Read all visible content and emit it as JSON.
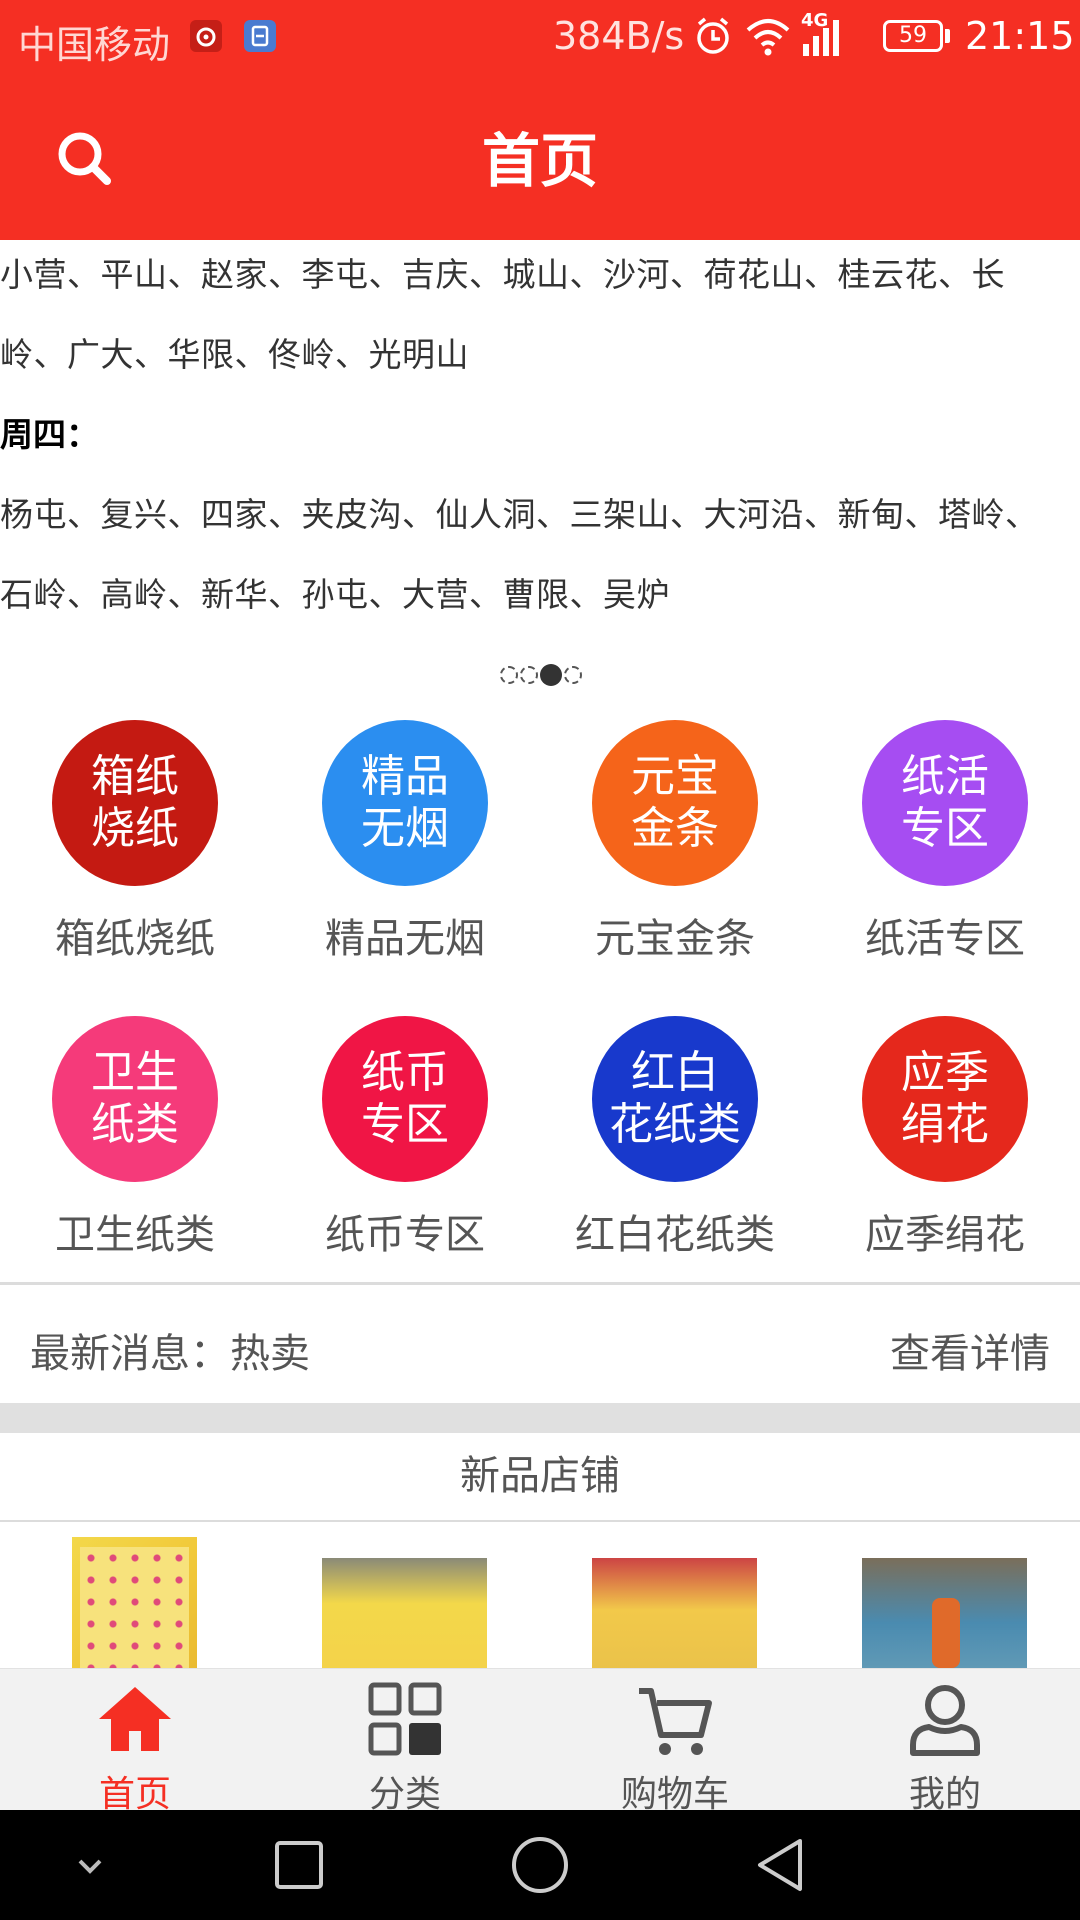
{
  "status_bar": {
    "carrier": "中国移动",
    "net_speed": "384B/s",
    "network_type": "4G",
    "battery": "59",
    "time": "21:15"
  },
  "header": {
    "title": "首页",
    "search_icon": "search-icon"
  },
  "banner": {
    "line1": "小营、平山、赵家、李屯、吉庆、城山、沙河、荷花山、桂云花、长",
    "line2": "岭、广大、华限、佟岭、光明山",
    "day_label": "周四：",
    "line3": "杨屯、复兴、四家、夹皮沟、仙人洞、三架山、大河沿、新甸、塔岭、",
    "line4": "石岭、高岭、新华、孙屯、大营、曹限、吴炉",
    "active_index": 2,
    "page_count": 4
  },
  "categories": [
    {
      "circle_line1": "箱纸",
      "circle_line2": "烧纸",
      "label": "箱纸烧纸",
      "color": "#c41a12"
    },
    {
      "circle_line1": "精品",
      "circle_line2": "无烟",
      "label": "精品无烟",
      "color": "#2b8ef0"
    },
    {
      "circle_line1": "元宝",
      "circle_line2": "金条",
      "label": "元宝金条",
      "color": "#f5641a"
    },
    {
      "circle_line1": "纸活",
      "circle_line2": "专区",
      "label": "纸活专区",
      "color": "#a64df2"
    },
    {
      "circle_line1": "卫生",
      "circle_line2": "纸类",
      "label": "卫生纸类",
      "color": "#f53a7a"
    },
    {
      "circle_line1": "纸币",
      "circle_line2": "专区",
      "label": "纸币专区",
      "color": "#f01545"
    },
    {
      "circle_line1": "红白",
      "circle_line2": "花纸类",
      "label": "红白花纸类",
      "color": "#1839cc"
    },
    {
      "circle_line1": "应季",
      "circle_line2": "绢花",
      "label": "应季绢花",
      "color": "#e5281c"
    }
  ],
  "news": {
    "label": "最新消息：热卖",
    "link": "查看详情"
  },
  "new_shops": {
    "title": "新品店铺"
  },
  "tab_bar": {
    "items": [
      {
        "label": "首页",
        "icon": "home-icon",
        "active": true
      },
      {
        "label": "分类",
        "icon": "grid-icon",
        "active": false
      },
      {
        "label": "购物车",
        "icon": "cart-icon",
        "active": false
      },
      {
        "label": "我的",
        "icon": "user-icon",
        "active": false
      }
    ]
  },
  "nav_bar": {
    "buttons": [
      "chevron-down-icon",
      "recent-apps-icon",
      "home-circle-icon",
      "back-icon"
    ]
  },
  "colors": {
    "brand_red": "#f52f23",
    "tab_inactive": "#555555",
    "background": "#ffffff"
  }
}
